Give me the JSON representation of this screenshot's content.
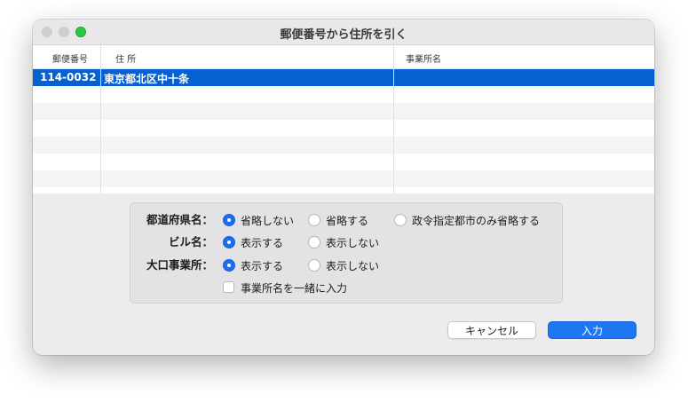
{
  "window": {
    "title": "郵便番号から住所を引く"
  },
  "table": {
    "headers": [
      "郵便番号",
      "住 所",
      "事業所名"
    ],
    "rows": [
      {
        "zip": "114-0032",
        "address": "東京都北区中十条",
        "business": ""
      }
    ]
  },
  "options": {
    "prefecture": {
      "label": "都道府県名：",
      "choices": [
        "省略しない",
        "省略する",
        "政令指定都市のみ省略する"
      ],
      "selected": "省略しない"
    },
    "building": {
      "label": "ビル名：",
      "choices": [
        "表示する",
        "表示しない"
      ],
      "selected": "表示する"
    },
    "large_office": {
      "label": "大口事業所：",
      "choices": [
        "表示する",
        "表示しない"
      ],
      "selected": "表示する"
    },
    "include_business_name": {
      "label": "事業所名を一緒に入力",
      "checked": false
    }
  },
  "buttons": {
    "cancel": "キャンセル",
    "ok": "入力"
  },
  "colors": {
    "accent": "#0560d2",
    "button_primary": "#1f76f2"
  }
}
